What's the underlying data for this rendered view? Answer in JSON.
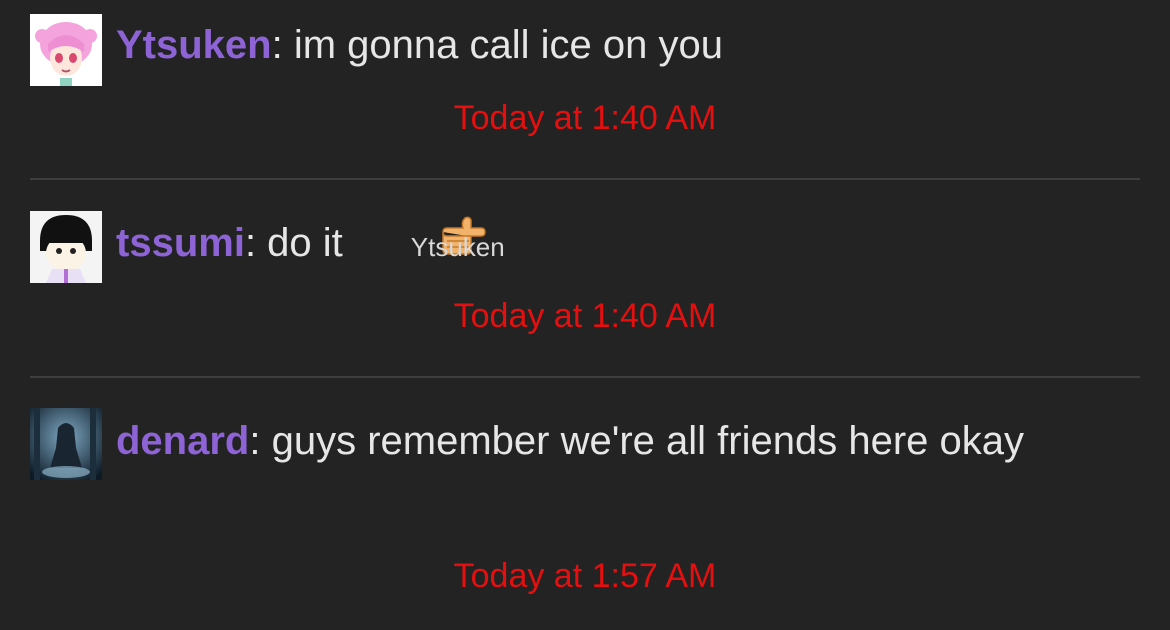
{
  "messages": [
    {
      "user": "Ytsuken",
      "text": ": im gonna call ice on you",
      "time": "Today at 1:40 AM"
    },
    {
      "user": "tssumi",
      "text": ": do it",
      "reaction_icon": "thumbs-right-emoji",
      "mention": "Ytsuken",
      "time": "Today at 1:40 AM"
    },
    {
      "user": "denard",
      "text": ": guys remember we're all friends here okay",
      "time": "Today at 1:57 AM"
    }
  ],
  "colors": {
    "background": "#232323",
    "username": "#8e63d6",
    "timestamp": "#e60f0f",
    "text": "#e6e6e6",
    "divider": "#3e3e3e"
  }
}
